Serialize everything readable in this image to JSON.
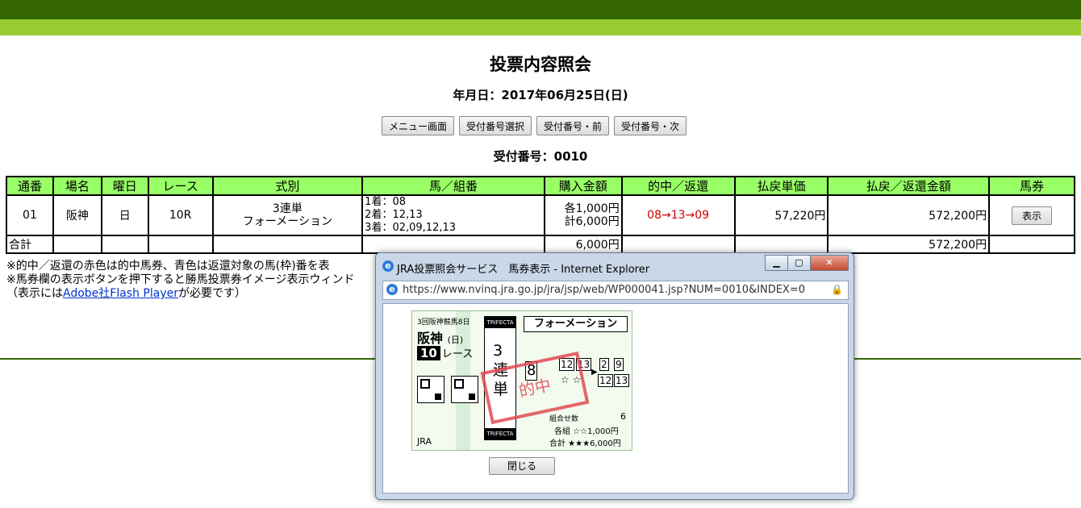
{
  "page": {
    "title": "投票内容照会",
    "date_line": "年月日：2017年06月25日(日)",
    "buttons": [
      "メニュー画面",
      "受付番号選択",
      "受付番号・前",
      "受付番号・次"
    ],
    "receipt_line": "受付番号：0010"
  },
  "table": {
    "headers": [
      "通番",
      "場名",
      "曜日",
      "レース",
      "式別",
      "馬／組番",
      "購入金額",
      "的中／返還",
      "払戻単価",
      "払戻／返還金額",
      "馬券"
    ],
    "row": {
      "no": "01",
      "venue": "阪神",
      "weekday": "日",
      "race": "10R",
      "bet_type_1": "3連単",
      "bet_type_2": "フォーメーション",
      "combo_1": "1着：08",
      "combo_2": "2着：12,13",
      "combo_3": "3着：02,09,12,13",
      "amount_each": "各1,000円",
      "amount_total": "計6,000円",
      "hit": "08→13→09",
      "unit_payout": "57,220円",
      "payout": "572,200円",
      "show_button": "表示"
    },
    "total": {
      "label": "合計",
      "amount": "6,000円",
      "payout": "572,200円"
    }
  },
  "notes": {
    "line1": "※的中／返還の赤色は的中馬券、青色は返還対象の馬(枠)番を表",
    "line2": "※馬券欄の表示ボタンを押下すると勝馬投票券イメージ表示ウィンド",
    "line3_pre": "（表示には",
    "line3_link": "Adobe社Flash Player",
    "line3_post": "が必要です）"
  },
  "popup": {
    "window_title": "JRA投票照会サービス　馬券表示 - Internet Explorer",
    "url": "https://www.nvinq.jra.go.jp/jra/jsp/web/WP000041.jsp?NUM=0010&INDEX=0",
    "close_button": "閉じる",
    "min_glyph": "▁",
    "max_glyph": "▢",
    "close_glyph": "✕",
    "ticket": {
      "series": "3回阪神競馬8日",
      "venue": "阪神",
      "day": "(日)",
      "race_num": "10",
      "race_label": "レース",
      "trifecta_top": "TRIFECTA",
      "trifecta_bottom": "TRIFECTA",
      "bet_type": "3\n連\n単",
      "formation": "フォーメーション",
      "stamp": "的中",
      "first": "8",
      "second_a": "12",
      "second_b": "13",
      "third_a": "2",
      "third_b": "9",
      "third_c": "12",
      "third_d": "13",
      "stars_second": "☆ ☆",
      "combos_label": "組合せ数",
      "combos_value": "6",
      "each_label": "各組 ☆☆1,000円",
      "total_label": "合計 ★★★6,000円",
      "jra": "JRA"
    }
  }
}
